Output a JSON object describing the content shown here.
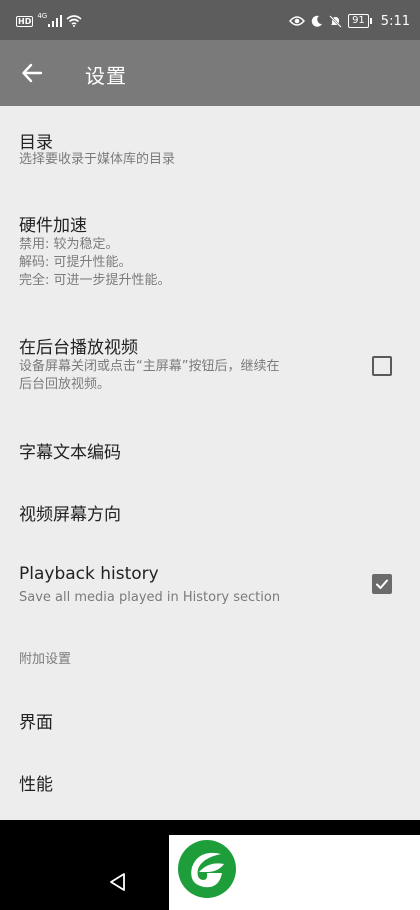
{
  "status_bar": {
    "hd_badge": "HD",
    "network": "4G",
    "battery": "91",
    "time": "5:11"
  },
  "app_bar": {
    "title": "设置",
    "back_icon": "arrow-left-icon"
  },
  "preferences": [
    {
      "title": "目录",
      "summary": "选择要收录于媒体库的目录"
    },
    {
      "title": "硬件加速",
      "summary": "禁用: 较为稳定。\n解码: 可提升性能。\n完全: 可进一步提升性能。"
    },
    {
      "title": "在后台播放视频",
      "summary": "设备屏幕关闭或点击“主屏幕”按钮后，继续在\n后台回放视频。",
      "checked": false
    },
    {
      "title": "字幕文本编码"
    },
    {
      "title": "视频屏幕方向"
    },
    {
      "title": "Playback history",
      "summary": "Save all media played in History section",
      "checked": true
    }
  ],
  "category": {
    "title": "附加设置"
  },
  "extra_preferences": [
    {
      "title": "界面"
    },
    {
      "title": "性能"
    }
  ],
  "navigation": {
    "back_icon": "triangle-back-icon"
  },
  "colors": {
    "status_bar": "#5d5d5d",
    "app_bar": "#7a7a7a",
    "background": "#ededed",
    "logo_green": "#1e9e3a"
  }
}
